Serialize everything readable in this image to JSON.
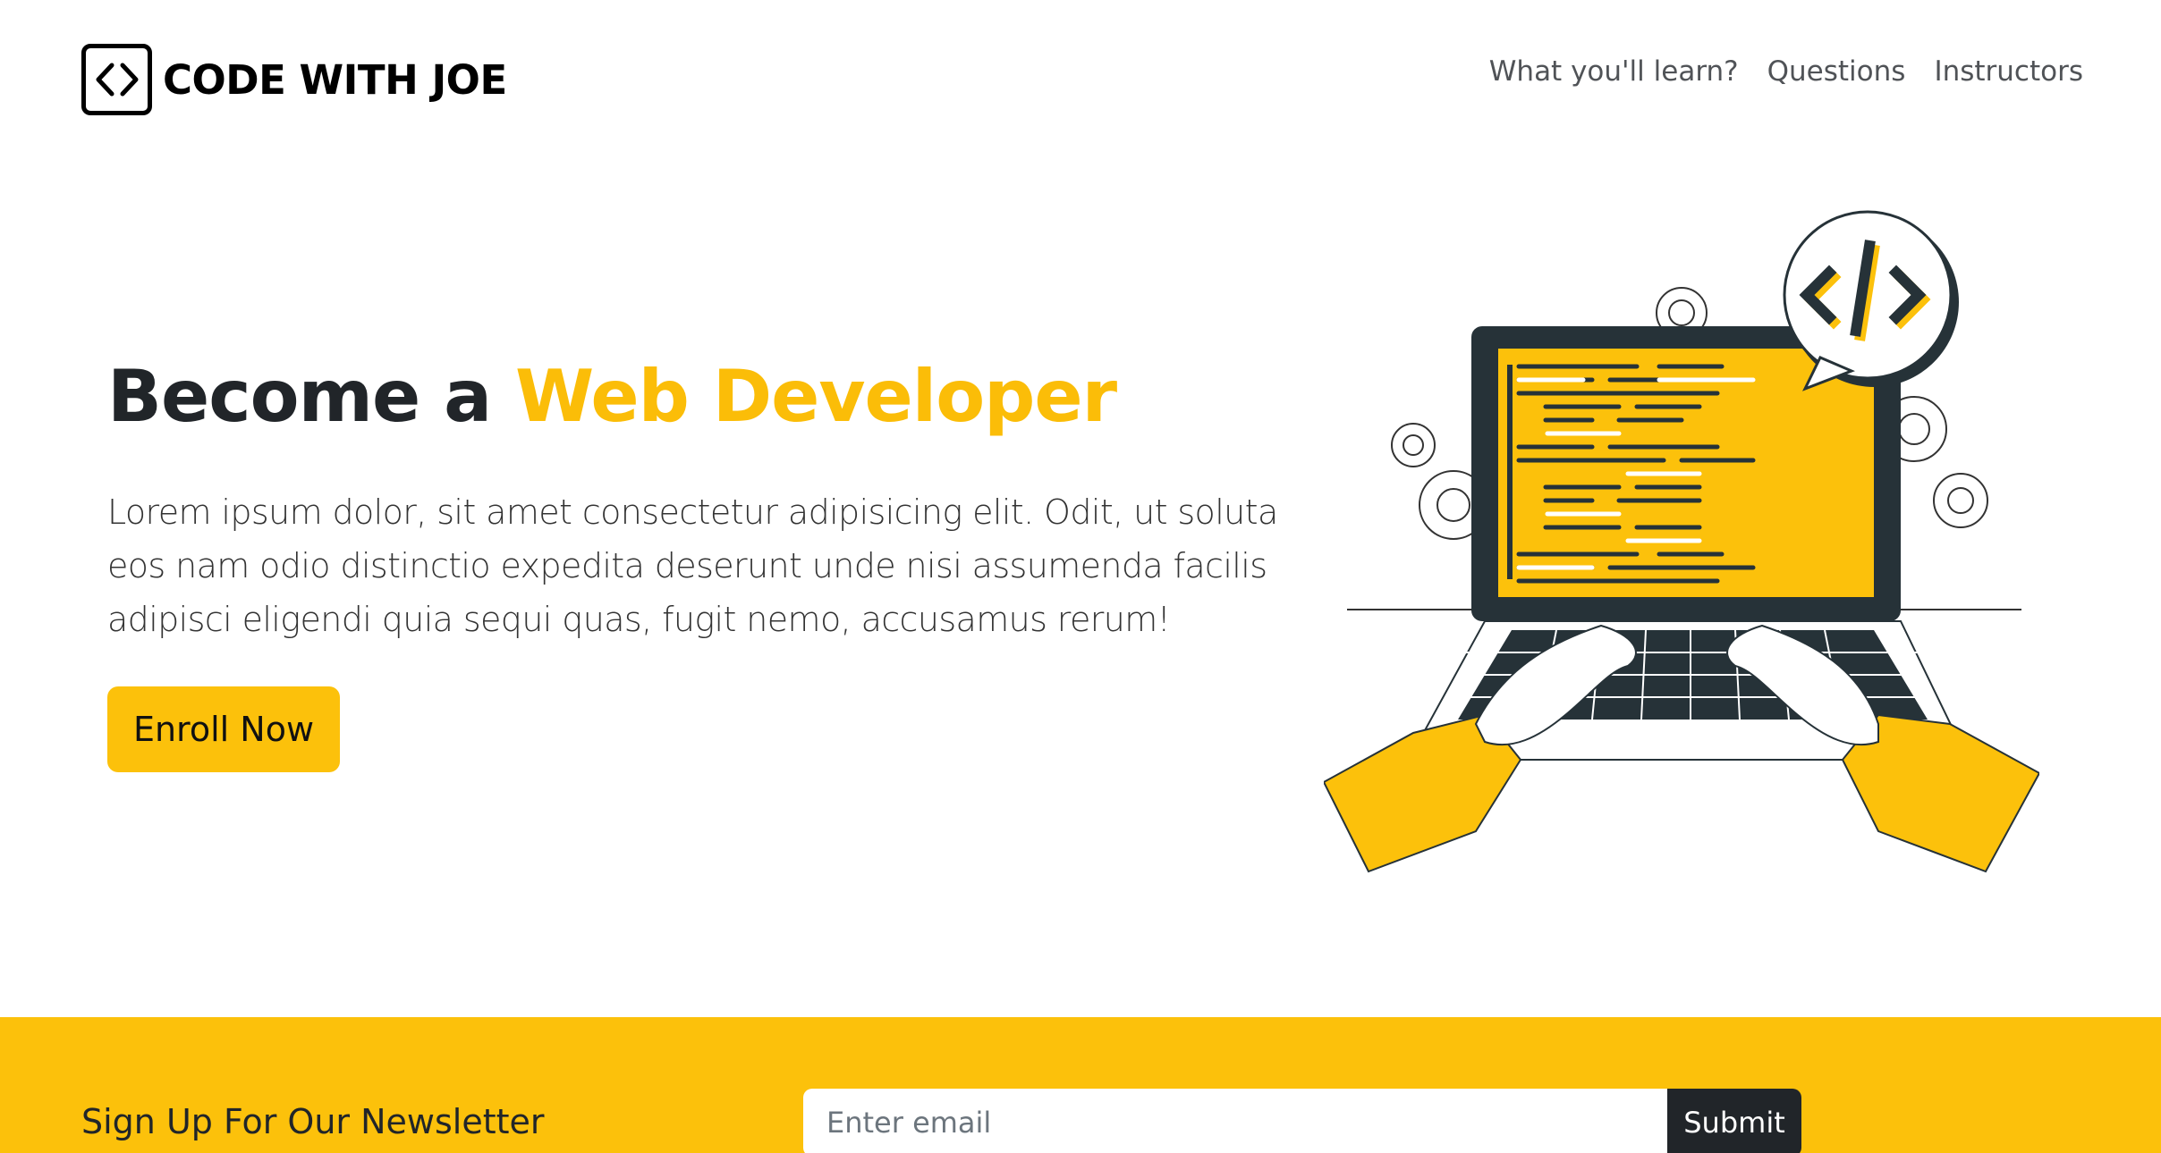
{
  "brand": {
    "name": "CODE WITH JOE",
    "icon": "code-brackets-icon"
  },
  "nav": {
    "items": [
      {
        "label": "What you'll learn?"
      },
      {
        "label": "Questions"
      },
      {
        "label": "Instructors"
      }
    ]
  },
  "hero": {
    "title_prefix": "Become a",
    "title_highlight": "Web Developer",
    "description": "Lorem ipsum dolor, sit amet consectetur adipisicing elit. Odit, ut soluta eos nam odio distinctio expedita deserunt unde nisi assumenda facilis adipisci eligendi quia sequi quas, fugit nemo, accusamus rerum!",
    "cta_label": "Enroll Now",
    "illustration": "developer-laptop-illustration"
  },
  "newsletter": {
    "title": "Sign Up For Our Newsletter",
    "email_placeholder": "Enter email",
    "email_value": "",
    "submit_label": "Submit"
  },
  "colors": {
    "accent": "#fcc10b",
    "dark": "#212529",
    "highlight_text": "#fbbd08"
  }
}
